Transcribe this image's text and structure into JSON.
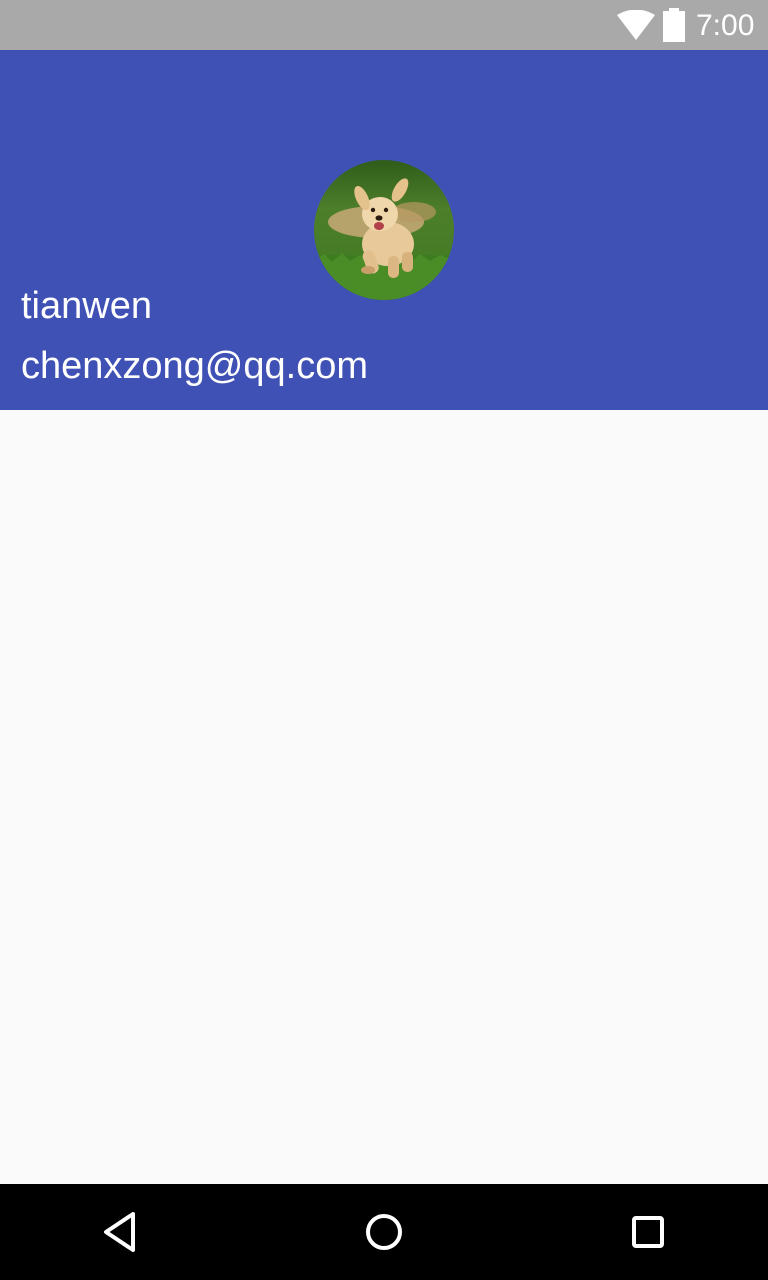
{
  "status_bar": {
    "time": "7:00",
    "icons": [
      "wifi-icon",
      "battery-icon"
    ]
  },
  "header": {
    "background_color": "#3f51b5",
    "avatar": {
      "icon": "dog-photo-avatar"
    },
    "user_name": "tianwen",
    "user_email": "chenxzong@qq.com"
  },
  "content": {
    "background_color": "#fafafa"
  },
  "nav_bar": {
    "buttons": [
      {
        "name": "back",
        "icon": "back-triangle-icon"
      },
      {
        "name": "home",
        "icon": "home-circle-icon"
      },
      {
        "name": "recents",
        "icon": "recents-square-icon"
      }
    ]
  }
}
